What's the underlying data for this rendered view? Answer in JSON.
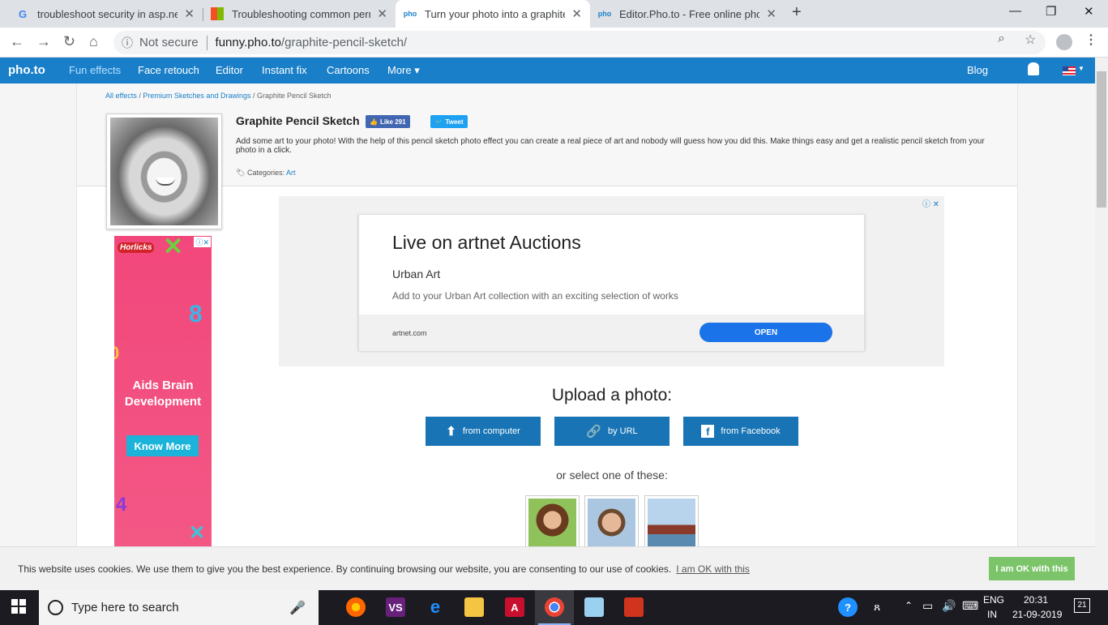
{
  "browser": {
    "tabs": [
      {
        "title": "troubleshoot security in asp.net -",
        "favicon": "google-g-icon"
      },
      {
        "title": "Troubleshooting common permis",
        "favicon": "windows-icon"
      },
      {
        "title": "Turn your photo into a graphite p",
        "favicon": "photo-icon",
        "active": true
      },
      {
        "title": "Editor.Pho.to - Free online photo",
        "favicon": "photo-icon"
      }
    ],
    "new_tab": "+",
    "window_controls": {
      "minimize": "—",
      "restore": "❐",
      "close": "✕"
    },
    "security_label": "Not secure",
    "url_host": "funny.pho.to",
    "url_path": "/graphite-pencil-sketch/"
  },
  "site_nav": {
    "logo": "pho.to",
    "items": [
      "Fun effects",
      "Face retouch",
      "Editor",
      "Instant fix",
      "Cartoons",
      "More ▾"
    ],
    "blog": "Blog"
  },
  "breadcrumb": {
    "items": [
      "All effects",
      "Premium Sketches and Drawings",
      "Graphite Pencil Sketch"
    ],
    "separator": "/"
  },
  "effect": {
    "title": "Graphite Pencil Sketch",
    "like_label": "Like 291",
    "tweet_label": "Tweet",
    "description": "Add some art to your photo! With the help of this pencil sketch photo effect you can create a real piece of art and nobody will guess how you did this. Make things easy and get a realistic pencil sketch from your photo in a click.",
    "categories_label": "Categories:",
    "category": "Art"
  },
  "side_ad": {
    "brand": "Horlicks",
    "text": "Aids Brain Development",
    "button": "Know More"
  },
  "main_ad": {
    "headline": "Live on artnet Auctions",
    "subhead": "Urban Art",
    "description": "Add to your Urban Art collection with an exciting selection of works",
    "domain": "artnet.com",
    "button": "OPEN",
    "adchoices": "ⓘ ✕"
  },
  "upload": {
    "title": "Upload a photo:",
    "buttons": [
      "from computer",
      "by URL",
      "from Facebook"
    ],
    "select_text": "or select one of these:"
  },
  "cookie": {
    "message": "This website uses cookies. We use them to give you the best experience. By continuing browsing our website, you are consenting to our use of cookies.",
    "link": "I am OK with this",
    "button": "I am OK with this"
  },
  "taskbar": {
    "search_placeholder": "Type here to search",
    "language": "ENG",
    "region": "IN",
    "time": "20:31",
    "date": "21-09-2019",
    "notifications": "21"
  },
  "colors": {
    "brand_blue": "#1a7fc9",
    "upload_blue": "#1874b4",
    "ad_pink": "#f2477c",
    "accept_green": "#7cc46a"
  }
}
